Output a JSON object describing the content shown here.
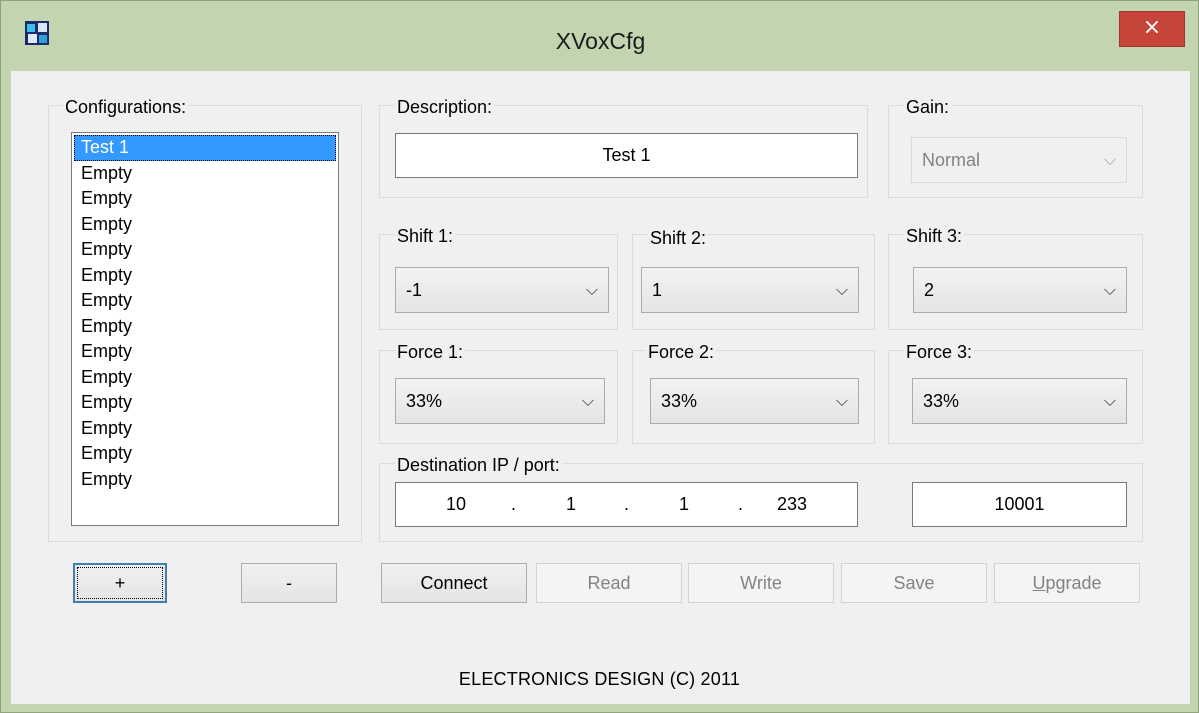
{
  "window": {
    "title": "XVoxCfg",
    "close_glyph": "×"
  },
  "configurations": {
    "label": "Configurations:",
    "items": [
      "Test 1",
      "Empty",
      "Empty",
      "Empty",
      "Empty",
      "Empty",
      "Empty",
      "Empty",
      "Empty",
      "Empty",
      "Empty",
      "Empty",
      "Empty",
      "Empty"
    ],
    "selected_index": 0,
    "add_label": "+",
    "remove_label": "-"
  },
  "description": {
    "label": "Description:",
    "value": "Test 1"
  },
  "gain": {
    "label": "Gain:",
    "value": "Normal",
    "enabled": false
  },
  "shifts": [
    {
      "label": "Shift 1:",
      "value": "-1"
    },
    {
      "label": "Shift 2:",
      "value": "1"
    },
    {
      "label": "Shift 3:",
      "value": "2"
    }
  ],
  "forces": [
    {
      "label": "Force 1:",
      "value": "33%"
    },
    {
      "label": "Force 2:",
      "value": "33%"
    },
    {
      "label": "Force 3:",
      "value": "33%"
    }
  ],
  "destination": {
    "label": "Destination IP / port:",
    "ip": [
      "10",
      "1",
      "1",
      "233"
    ],
    "dot": ".",
    "port": "10001"
  },
  "actions": {
    "connect": "Connect",
    "read": "Read",
    "write": "Write",
    "save": "Save",
    "upgrade": "Upgrade"
  },
  "footer": "ELECTRONICS DESIGN (C) 2011",
  "icons": {
    "combo_arrow": "chevron-down-icon",
    "app": "app-icon",
    "close": "close-icon"
  },
  "colors": {
    "selection": "#3399ff",
    "close_button": "#c7443a",
    "frame": "#c3d4b0"
  }
}
